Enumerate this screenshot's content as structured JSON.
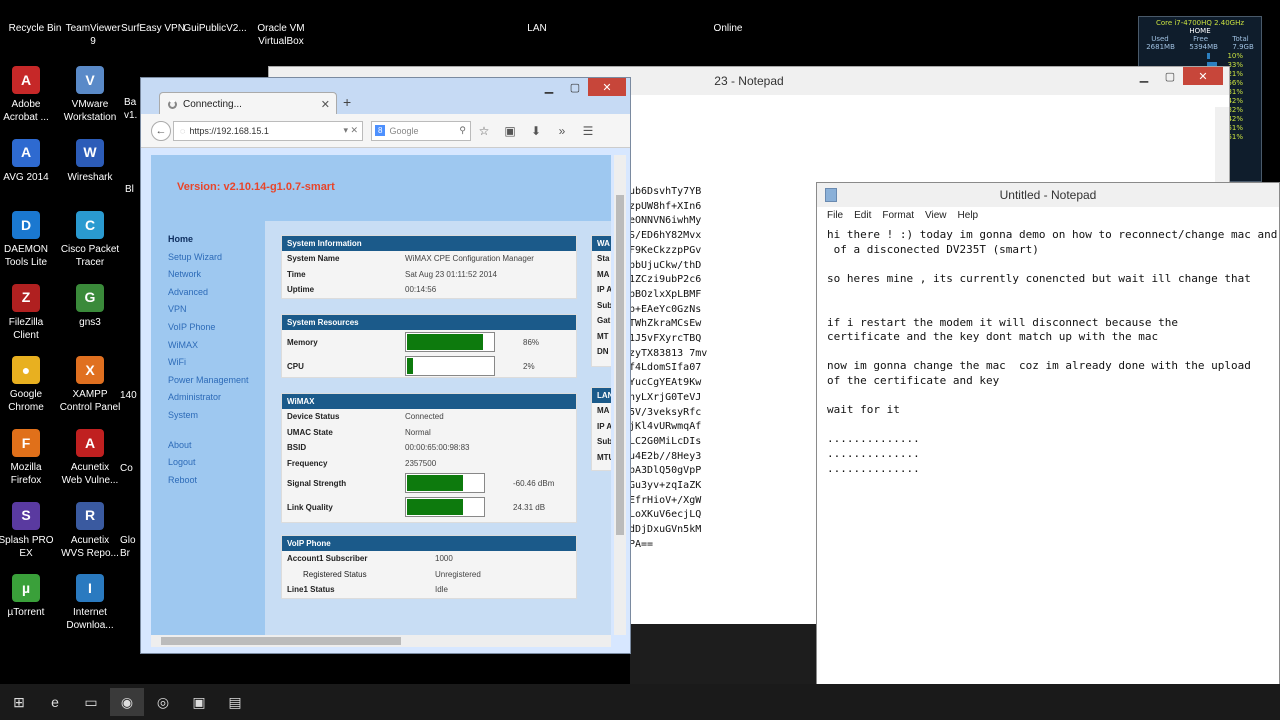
{
  "desktop": {
    "top_labels": [
      {
        "label": "Recycle Bin"
      },
      {
        "label": "TeamViewer\n9"
      },
      {
        "label": "SurfEasy VPN"
      },
      {
        "label": "GuiPublicV2..."
      },
      {
        "label": "Oracle VM\nVirtualBox"
      },
      {
        "label": "LAN"
      },
      {
        "label": "Online"
      }
    ],
    "icons": [
      {
        "label": "Adobe\nAcrobat ...",
        "icon": "acrobat-icon",
        "glyph": "A",
        "color": "#c62828"
      },
      {
        "label": "VMware\nWorkstation",
        "icon": "vmware-icon",
        "glyph": "V",
        "color": "#5a8ac8"
      },
      {
        "label": "AVG 2014",
        "icon": "avg-icon",
        "glyph": "A",
        "color": "#2e6ad0"
      },
      {
        "label": "Wireshark",
        "icon": "wireshark-icon",
        "glyph": "W",
        "color": "#2c5cb8"
      },
      {
        "label": "DAEMON\nTools Lite",
        "icon": "daemon-icon",
        "glyph": "D",
        "color": "#1a78d0"
      },
      {
        "label": "Cisco Packet\nTracer",
        "icon": "cisco-icon",
        "glyph": "C",
        "color": "#2a9ad0"
      },
      {
        "label": "FileZilla\nClient",
        "icon": "filezilla-icon",
        "glyph": "Z",
        "color": "#b02020"
      },
      {
        "label": "gns3",
        "icon": "gns3-icon",
        "glyph": "G",
        "color": "#3a8a3a"
      },
      {
        "label": "Google\nChrome",
        "icon": "chrome-icon",
        "glyph": "●",
        "color": "#e8b020"
      },
      {
        "label": "XAMPP\nControl Panel",
        "icon": "xampp-icon",
        "glyph": "X",
        "color": "#e07020"
      },
      {
        "label": "Mozilla\nFirefox",
        "icon": "firefox-icon",
        "glyph": "F",
        "color": "#e0701a"
      },
      {
        "label": "Acunetix\nWeb Vulne...",
        "icon": "acunetix-icon",
        "glyph": "A",
        "color": "#c02020"
      },
      {
        "label": "Splash PRO\nEX",
        "icon": "splash-icon",
        "glyph": "S",
        "color": "#5a3aa0"
      },
      {
        "label": "Acunetix\nWVS Repo...",
        "icon": "acunetix-report-icon",
        "glyph": "R",
        "color": "#3a5aa0"
      },
      {
        "label": "µTorrent",
        "icon": "utorrent-icon",
        "glyph": "µ",
        "color": "#3aa03a"
      },
      {
        "label": "Internet\nDownloa...",
        "icon": "idm-icon",
        "glyph": "I",
        "color": "#2a7ac0"
      }
    ],
    "partial_labels": [
      {
        "label": "Ba\nv1."
      },
      {
        "label": "Bl"
      },
      {
        "label": "140"
      },
      {
        "label": "Co"
      },
      {
        "label": "Glo\nBr"
      }
    ]
  },
  "cpu_widget": {
    "title": "Core i7-4700HQ 2.40GHz",
    "home": "HOME",
    "headers": [
      "Used",
      "Free",
      "Total"
    ],
    "values": [
      "2681MB",
      "5394MB",
      "7.9GB"
    ],
    "bars": [
      {
        "pct": "10%",
        "fill": 0.1
      },
      {
        "pct": "33%",
        "fill": 0.33
      },
      {
        "pct": "21%",
        "fill": 0.21
      },
      {
        "pct": "56%",
        "fill": 0.56
      },
      {
        "pct": "31%",
        "fill": 0.31
      },
      {
        "pct": "42%",
        "fill": 0.42
      },
      {
        "pct": "32%",
        "fill": 0.32
      },
      {
        "pct": "42%",
        "fill": 0.42
      },
      {
        "pct": "51%",
        "fill": 0.51
      },
      {
        "pct": "51%",
        "fill": 0.51
      }
    ]
  },
  "notepad_back": {
    "title": "23 - Notepad",
    "lines": [
      "ub6DsvhTy7YB",
      "zpUW8hf+XIn6",
      "eONNVN6iwhMy",
      "S/ED6hY82Mvx",
      "F9KeCkzzpPGv",
      "pbUjuCkw/thD",
      "1ZCzi9ubP2c6",
      "pBOzlxXpLBMF",
      "p+EAeYc0GzNs",
      "TWhZkraMCsEw",
      "1J5vFXyrcTBQ",
      "zyTX83813 7mv",
      "f4LdomSIfa07",
      "YucCgYEAt9Kw",
      "hyLXrjG0TeVJ",
      "5V/3veksyRfc",
      "jKl4vURwmqAf",
      "LC2G0MiLcDIs",
      "u4E2b//8Hey3",
      "bA3DlQ50gVpP",
      "Gu3yv+zqIaZK",
      "EfrHioV+/XgW",
      "LoXKuV6ecjLQ",
      "dDjDxuGVn5kM",
      "PA=="
    ]
  },
  "notepad_front": {
    "title": "Untitled - Notepad",
    "menu": [
      "File",
      "Edit",
      "Format",
      "View",
      "Help"
    ],
    "text": "hi there ! :) today im gonna demo on how to reconnect/change mac and\n of a disconected DV235T (smart)\n\nso heres mine , its currently conencted but wait ill change that\n\n\nif i restart the modem it will disconnect because the\ncertificate and the key dont match up with the mac\n\nnow im gonna change the mac  coz im already done with the upload\nof the certificate and key\n\nwait for it\n\n..............\n..............\n.............."
  },
  "firefox": {
    "tab_title": "Connecting...",
    "url": "https://192.168.15.1",
    "search_placeholder": "Google"
  },
  "router": {
    "version": "Version: v2.10.14-g1.0.7-smart",
    "menu": [
      "Home",
      "Setup Wizard",
      "Network",
      "Advanced",
      "VPN",
      "VoIP Phone",
      "WiMAX",
      "WiFi",
      "Power Management",
      "Administrator",
      "System"
    ],
    "menu2": [
      "About",
      "Logout",
      "Reboot"
    ],
    "system_info": {
      "title": "System Information",
      "rows": [
        {
          "k": "System Name",
          "v": "WiMAX CPE Configuration Manager"
        },
        {
          "k": "Time",
          "v": "Sat Aug 23 01:11:52 2014"
        },
        {
          "k": "Uptime",
          "v": "00:14:56"
        }
      ]
    },
    "resources": {
      "title": "System Resources",
      "memory_label": "Memory",
      "memory_pct": "86%",
      "memory_fill": 0.86,
      "cpu_label": "CPU",
      "cpu_pct": "2%",
      "cpu_fill": 0.02
    },
    "wimax": {
      "title": "WiMAX",
      "rows": [
        {
          "k": "Device Status",
          "v": "Connected"
        },
        {
          "k": "UMAC State",
          "v": "Normal"
        },
        {
          "k": "BSID",
          "v": "00:00:65:00:98:83"
        },
        {
          "k": "Frequency",
          "v": "2357500"
        }
      ],
      "signal_label": "Signal Strength",
      "signal_val": "-60.46 dBm",
      "signal_fill": 0.72,
      "link_label": "Link Quality",
      "link_val": "24.31 dB",
      "link_fill": 0.72
    },
    "voip": {
      "title": "VoIP Phone",
      "rows": [
        {
          "k": "Account1 Subscriber",
          "v": "1000"
        },
        {
          "k": "Registered Status",
          "v": "Unregistered"
        },
        {
          "k": "Line1 Status",
          "v": "Idle"
        }
      ]
    },
    "right_panels": {
      "wan_title": "WA",
      "wan_rows": [
        "Sta",
        "MA",
        "IP A",
        "Sub",
        "Gat",
        "MT",
        "DN"
      ],
      "lan_title": "LAN",
      "lan_rows": [
        "MA",
        "IP A",
        "Sub",
        "MTU"
      ]
    }
  },
  "taskbar": {
    "items": [
      {
        "icon": "windows-start-icon",
        "glyph": "⊞"
      },
      {
        "icon": "ie-icon",
        "glyph": "e"
      },
      {
        "icon": "explorer-icon",
        "glyph": "▭"
      },
      {
        "icon": "firefox-taskbar-icon",
        "glyph": "◉"
      },
      {
        "icon": "chrome-taskbar-icon",
        "glyph": "◎"
      },
      {
        "icon": "xampp-taskbar-icon",
        "glyph": "▣"
      },
      {
        "icon": "notepad-taskbar-icon",
        "glyph": "▤"
      }
    ]
  }
}
